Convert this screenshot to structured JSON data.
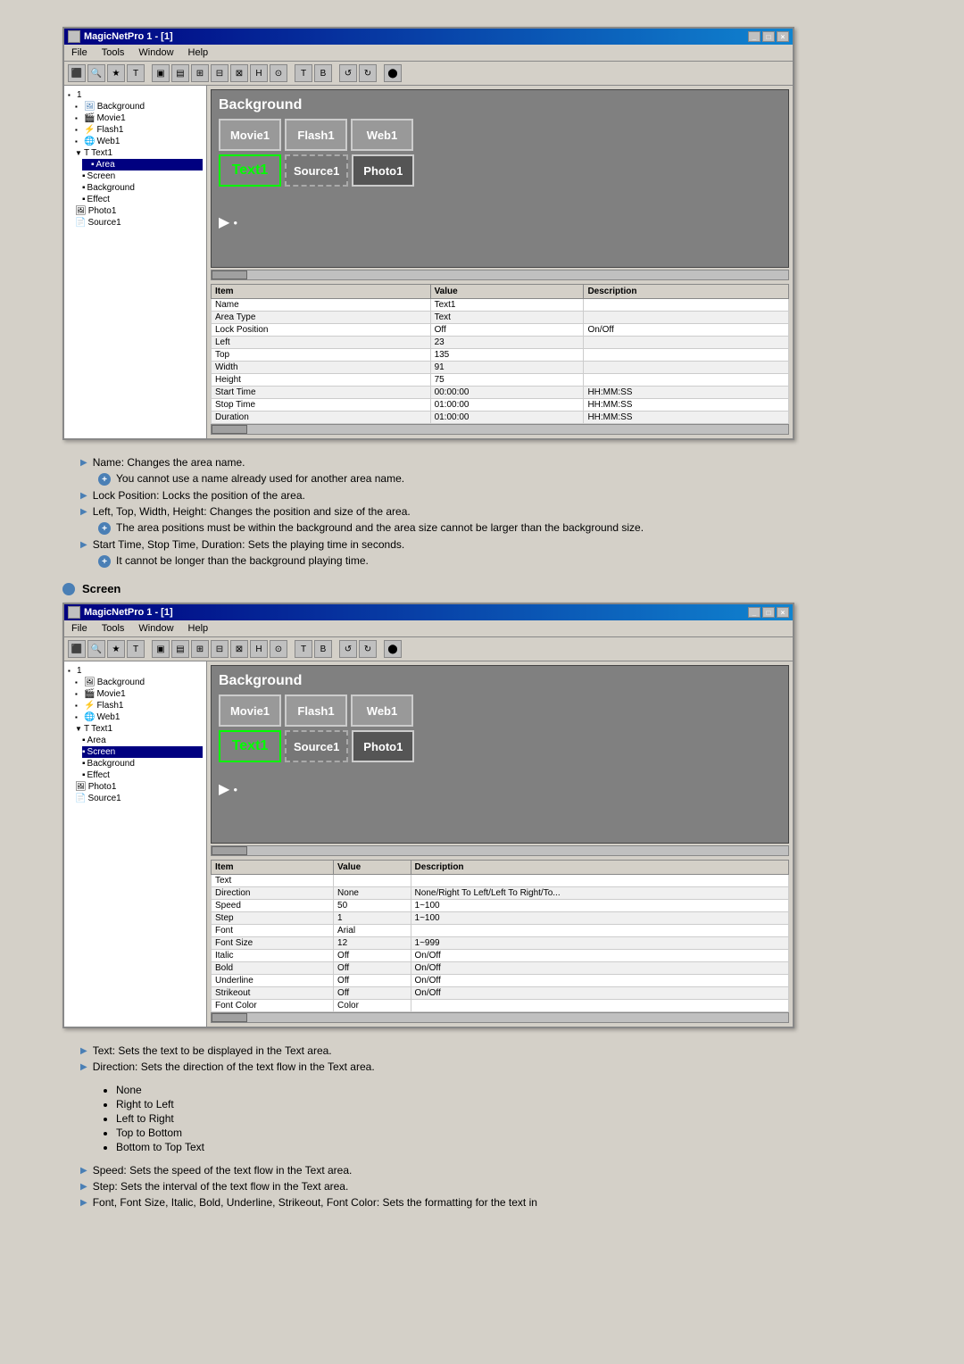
{
  "window1": {
    "title": "MagicNetPro 1 - [1]",
    "menus": [
      "File",
      "Tools",
      "Window",
      "Help"
    ],
    "tree": {
      "items": [
        {
          "label": "1",
          "level": 0,
          "icon": "folder",
          "expanded": true
        },
        {
          "label": "Background",
          "level": 1,
          "icon": "image"
        },
        {
          "label": "Movie1",
          "level": 1,
          "icon": "movie"
        },
        {
          "label": "Flash1",
          "level": 1,
          "icon": "flash"
        },
        {
          "label": "Web1",
          "level": 1,
          "icon": "web"
        },
        {
          "label": "Text1",
          "level": 1,
          "icon": "text",
          "expanded": true
        },
        {
          "label": "Area",
          "level": 2,
          "icon": "area",
          "selected": false
        },
        {
          "label": "Screen",
          "level": 2,
          "icon": "screen",
          "selected": false
        },
        {
          "label": "Background",
          "level": 2,
          "icon": "background"
        },
        {
          "label": "Effect",
          "level": 2,
          "icon": "effect"
        },
        {
          "label": "Photo1",
          "level": 1,
          "icon": "photo"
        },
        {
          "label": "Source1",
          "level": 1,
          "icon": "source"
        }
      ]
    },
    "canvas": {
      "title": "Background",
      "row1": [
        "Movie1",
        "Flash1",
        "Web1"
      ],
      "row2": [
        "Text1",
        "Source1",
        "Photo1"
      ]
    },
    "selected_tree_item": "Area",
    "props": {
      "headers": [
        "Item",
        "Value",
        "Description"
      ],
      "rows": [
        {
          "item": "Name",
          "value": "Text1",
          "desc": ""
        },
        {
          "item": "Area Type",
          "value": "Text",
          "desc": ""
        },
        {
          "item": "Lock Position",
          "value": "Off",
          "desc": "On/Off"
        },
        {
          "item": "Left",
          "value": "23",
          "desc": ""
        },
        {
          "item": "Top",
          "value": "135",
          "desc": ""
        },
        {
          "item": "Width",
          "value": "91",
          "desc": ""
        },
        {
          "item": "Height",
          "value": "75",
          "desc": ""
        },
        {
          "item": "Start Time",
          "value": "00:00:00",
          "desc": "HH:MM:SS"
        },
        {
          "item": "Stop Time",
          "value": "01:00:00",
          "desc": "HH:MM:SS"
        },
        {
          "item": "Duration",
          "value": "01:00:00",
          "desc": "HH:MM:SS"
        }
      ]
    }
  },
  "descriptions1": {
    "items": [
      {
        "arrow": true,
        "text": "Name: Changes the area name.",
        "sub": [
          {
            "plus": true,
            "text": "You cannot use a name already used for another area name."
          }
        ]
      },
      {
        "arrow": true,
        "text": "Lock Position: Locks the position of the area.",
        "sub": []
      },
      {
        "arrow": true,
        "text": "Left, Top, Width, Height: Changes the position and size of the area.",
        "sub": [
          {
            "plus": true,
            "text": "The area positions must be within the background and the area size cannot be larger than the background size."
          }
        ]
      },
      {
        "arrow": true,
        "text": "Start Time, Stop Time, Duration: Sets the playing time in seconds.",
        "sub": [
          {
            "plus": true,
            "text": "It cannot be longer than the background playing time."
          }
        ]
      }
    ]
  },
  "section2_label": "Screen",
  "window2": {
    "title": "MagicNetPro 1 - [1]",
    "menus": [
      "File",
      "Tools",
      "Window",
      "Help"
    ],
    "selected_tree_item": "Screen",
    "props2": {
      "headers": [
        "Item",
        "Value",
        "Description"
      ],
      "rows": [
        {
          "item": "Text",
          "value": "",
          "desc": ""
        },
        {
          "item": "Direction",
          "value": "None",
          "desc": "None/Right To Left/Left To Right/To..."
        },
        {
          "item": "Speed",
          "value": "50",
          "desc": "1~100"
        },
        {
          "item": "Step",
          "value": "1",
          "desc": "1~100"
        },
        {
          "item": "Font",
          "value": "Arial",
          "desc": ""
        },
        {
          "item": "Font Size",
          "value": "12",
          "desc": "1~999"
        },
        {
          "item": "Italic",
          "value": "Off",
          "desc": "On/Off"
        },
        {
          "item": "Bold",
          "value": "Off",
          "desc": "On/Off"
        },
        {
          "item": "Underline",
          "value": "Off",
          "desc": "On/Off"
        },
        {
          "item": "Strikeout",
          "value": "Off",
          "desc": "On/Off"
        },
        {
          "item": "Font Color",
          "value": "Color",
          "desc": ""
        }
      ]
    }
  },
  "descriptions2": {
    "items": [
      {
        "arrow": true,
        "text": "Text: Sets the text to be displayed in the Text area.",
        "sub": []
      },
      {
        "arrow": true,
        "text": "Direction: Sets the direction of the text flow in the Text area.",
        "sub": []
      }
    ],
    "direction_options": [
      "None",
      "Right to Left",
      "Left to Right",
      "Top to Bottom",
      "Bottom to Top Text"
    ],
    "more_items": [
      {
        "arrow": true,
        "text": "Speed: Sets the speed of the text flow in the Text area.",
        "sub": []
      },
      {
        "arrow": true,
        "text": "Step: Sets the interval of the text flow in the Text area.",
        "sub": []
      },
      {
        "arrow": true,
        "text": "Font, Font Size, Italic, Bold, Underline, Strikeout, Font Color: Sets the formatting for the text in",
        "sub": []
      }
    ]
  }
}
